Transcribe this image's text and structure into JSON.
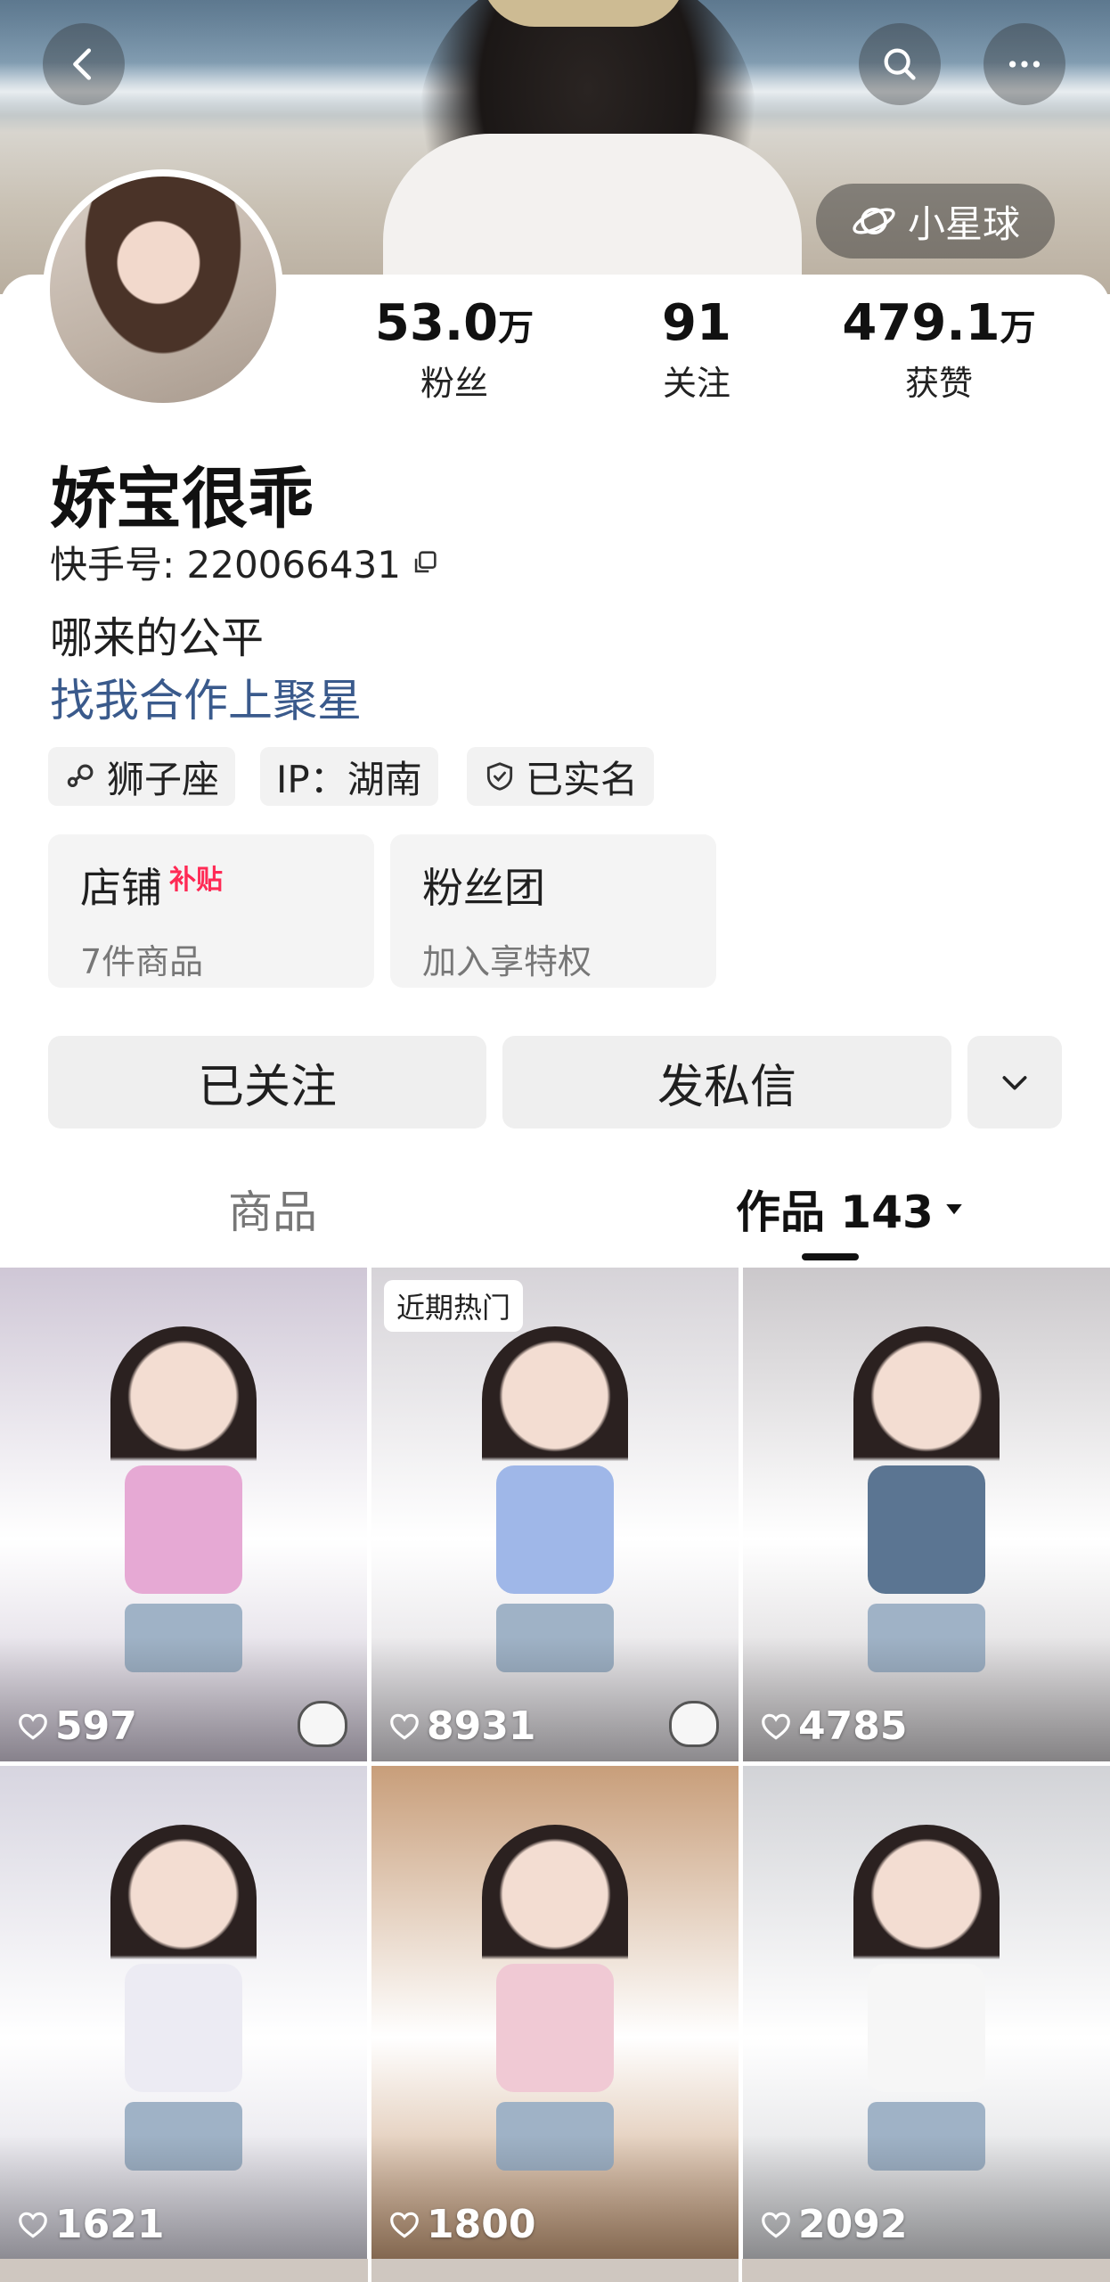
{
  "header": {
    "planet_label": "小星球"
  },
  "stats": [
    {
      "value": "53.0",
      "unit": "万",
      "label": "粉丝"
    },
    {
      "value": "91",
      "unit": "",
      "label": "关注"
    },
    {
      "value": "479.1",
      "unit": "万",
      "label": "获赞"
    }
  ],
  "profile": {
    "name": "娇宝很乖",
    "id_text": "快手号: 220066431",
    "bio": "哪来的公平",
    "bio_link": "找我合作上聚星"
  },
  "tags": [
    "狮子座",
    "IP：湖南",
    "已实名"
  ],
  "boxes": [
    {
      "title": "店铺",
      "badge": "补贴",
      "subtitle": "7件商品"
    },
    {
      "title": "粉丝团",
      "badge": "",
      "subtitle": "加入享特权"
    }
  ],
  "actions": {
    "follow": "已关注",
    "message": "发私信"
  },
  "tabs": {
    "goods": "商品",
    "works": "作品 143"
  },
  "posts": [
    {
      "likes": "597",
      "badge": "",
      "bg": "#cfc7d6",
      "top": "#e6a9d4"
    },
    {
      "likes": "8931",
      "badge": "近期热门",
      "bg": "#d6d3d8",
      "top": "#9fb7e8"
    },
    {
      "likes": "4785",
      "badge": "",
      "bg": "#cbc8cb",
      "top": "#5b7592"
    },
    {
      "likes": "1621",
      "badge": "",
      "bg": "#d7d5e0",
      "top": "#ecebf3"
    },
    {
      "likes": "1800",
      "badge": "",
      "bg": "#c89e7a",
      "top": "#f0c9d4"
    },
    {
      "likes": "2092",
      "badge": "",
      "bg": "#d2d3d7",
      "top": "#f6f6f6"
    }
  ],
  "colors": {
    "link": "#3a5a8c",
    "accent_red": "#ff2a55"
  }
}
